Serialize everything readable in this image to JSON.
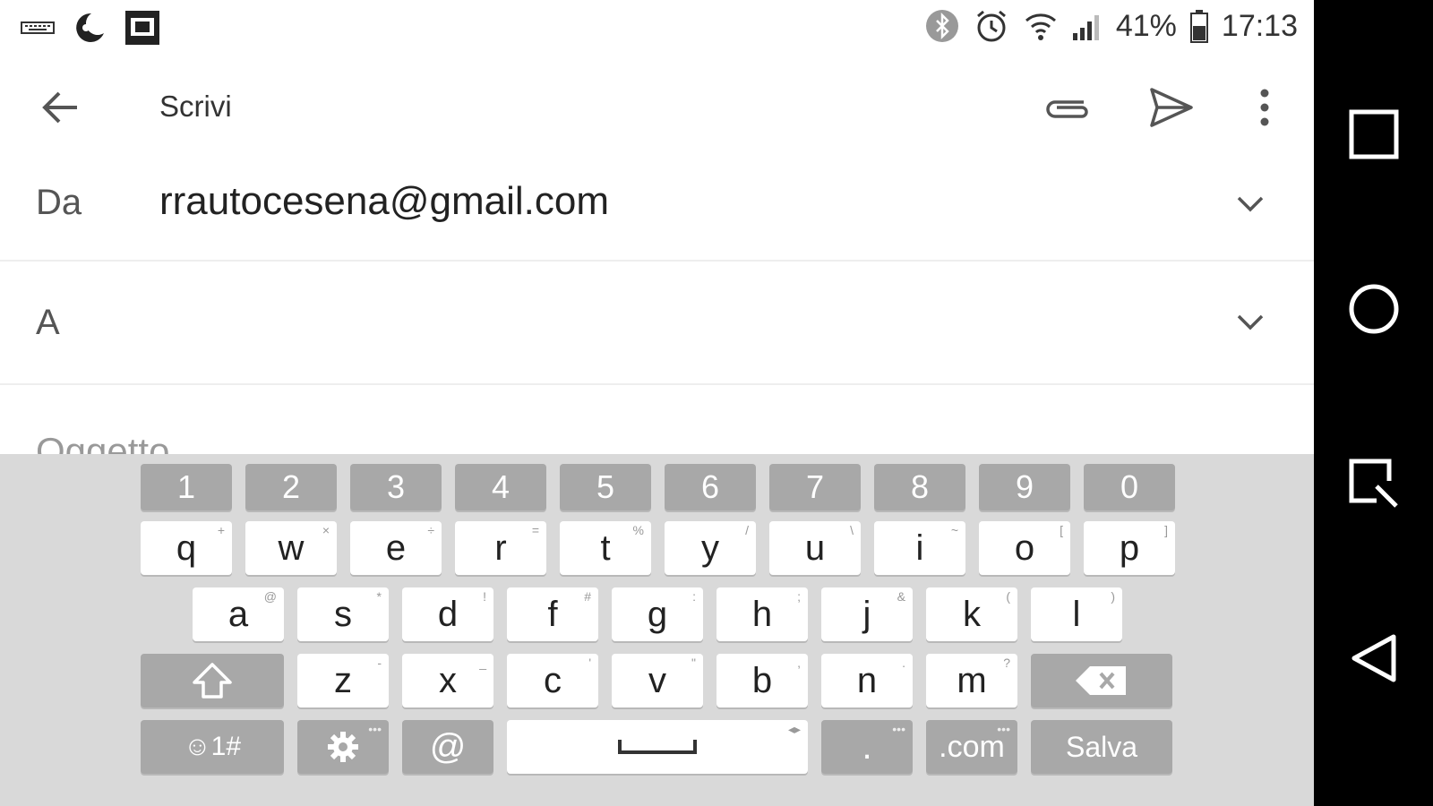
{
  "status_bar": {
    "battery": "41%",
    "time": "17:13",
    "icons": [
      "keyboard-icon",
      "moon-app-icon",
      "screenshot-app-icon",
      "bluetooth-icon",
      "alarm-icon",
      "wifi-icon",
      "signal-icon",
      "battery-icon"
    ]
  },
  "toolbar": {
    "title": "Scrivi",
    "icons": [
      "back-arrow-icon",
      "attach-icon",
      "send-icon",
      "more-vert-icon"
    ]
  },
  "compose": {
    "from_label": "Da",
    "from_value": "rrautocesena@gmail.com",
    "to_label": "A",
    "to_value": "",
    "subject_placeholder": "Oggetto"
  },
  "keyboard": {
    "number_row": [
      "1",
      "2",
      "3",
      "4",
      "5",
      "6",
      "7",
      "8",
      "9",
      "0"
    ],
    "row1": [
      {
        "k": "q",
        "s": "+"
      },
      {
        "k": "w",
        "s": "×"
      },
      {
        "k": "e",
        "s": "÷"
      },
      {
        "k": "r",
        "s": "="
      },
      {
        "k": "t",
        "s": "%"
      },
      {
        "k": "y",
        "s": "/"
      },
      {
        "k": "u",
        "s": "\\"
      },
      {
        "k": "i",
        "s": "~"
      },
      {
        "k": "o",
        "s": "["
      },
      {
        "k": "p",
        "s": "]"
      }
    ],
    "row2": [
      {
        "k": "a",
        "s": "@"
      },
      {
        "k": "s",
        "s": "*"
      },
      {
        "k": "d",
        "s": "!"
      },
      {
        "k": "f",
        "s": "#"
      },
      {
        "k": "g",
        "s": ":"
      },
      {
        "k": "h",
        "s": ";"
      },
      {
        "k": "j",
        "s": "&"
      },
      {
        "k": "k",
        "s": "("
      },
      {
        "k": "l",
        "s": ")"
      }
    ],
    "row3": [
      {
        "k": "z",
        "s": "-"
      },
      {
        "k": "x",
        "s": "_"
      },
      {
        "k": "c",
        "s": "'"
      },
      {
        "k": "v",
        "s": "\""
      },
      {
        "k": "b",
        "s": ","
      },
      {
        "k": "n",
        "s": "."
      },
      {
        "k": "m",
        "s": "?"
      }
    ],
    "bottom": {
      "symbols_label": "☺1#",
      "at_label": "@",
      "period_label": ".",
      "dotcom_label": ".com",
      "action_label": "Salva"
    }
  },
  "nav_bar": {
    "icons": [
      "recents-square-icon",
      "home-circle-icon",
      "capture-icon",
      "back-triangle-icon"
    ]
  }
}
